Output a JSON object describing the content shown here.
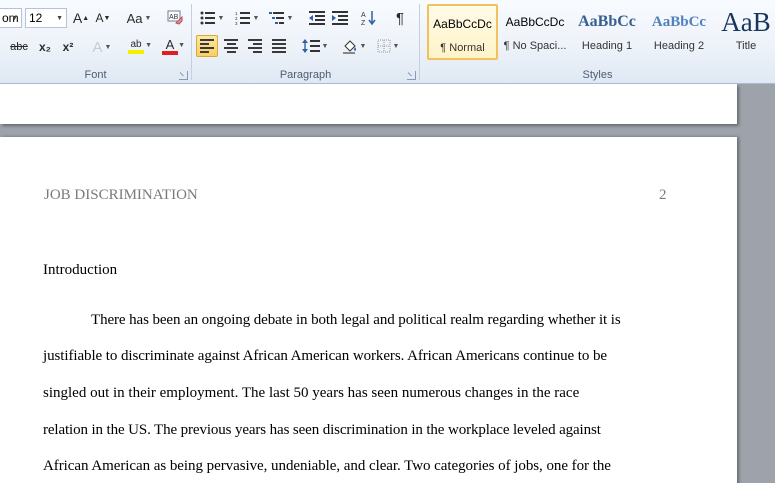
{
  "ribbon": {
    "font_group": {
      "label": "Font",
      "font_name": "om",
      "font_size": "12",
      "grow_label": "A",
      "shrink_label": "A",
      "case_label": "Aa",
      "strike_label": "abc",
      "subscript_label": "x₂",
      "superscript_label": "x²",
      "effects_label": "A",
      "highlight_label": "ab",
      "color_label": "A"
    },
    "paragraph_group": {
      "label": "Paragraph",
      "pilcrow": "¶"
    },
    "styles_group": {
      "label": "Styles",
      "styles": [
        {
          "sample": "AaBbCcDc",
          "name": "¶ Normal",
          "selected": true
        },
        {
          "sample": "AaBbCcDc",
          "name": "¶ No Spaci...",
          "selected": false
        },
        {
          "sample": "AaBbCc",
          "name": "Heading 1",
          "selected": false
        },
        {
          "sample": "AaBbCc",
          "name": "Heading 2",
          "selected": false
        },
        {
          "sample": "AaB",
          "name": "Title",
          "selected": false
        }
      ]
    },
    "colors": {
      "highlight": "#f3f000",
      "font_color": "#e02020",
      "heading1": "#365f91",
      "heading2": "#4f81bd",
      "title": "#17365d"
    }
  },
  "document": {
    "header_title": "JOB DISCRIMINATION",
    "page_number": "2",
    "heading": "Introduction",
    "lines": [
      "There has been an ongoing debate in both legal and political realm regarding whether it is",
      "justifiable to discriminate against African American workers. African Americans continue to be",
      "singled out in their employment. The last 50 years has seen numerous changes in the race",
      "relation in the US. The previous years has seen discrimination in the workplace leveled against",
      "African American as being pervasive, undeniable, and clear. Two categories of jobs, one for the"
    ]
  }
}
